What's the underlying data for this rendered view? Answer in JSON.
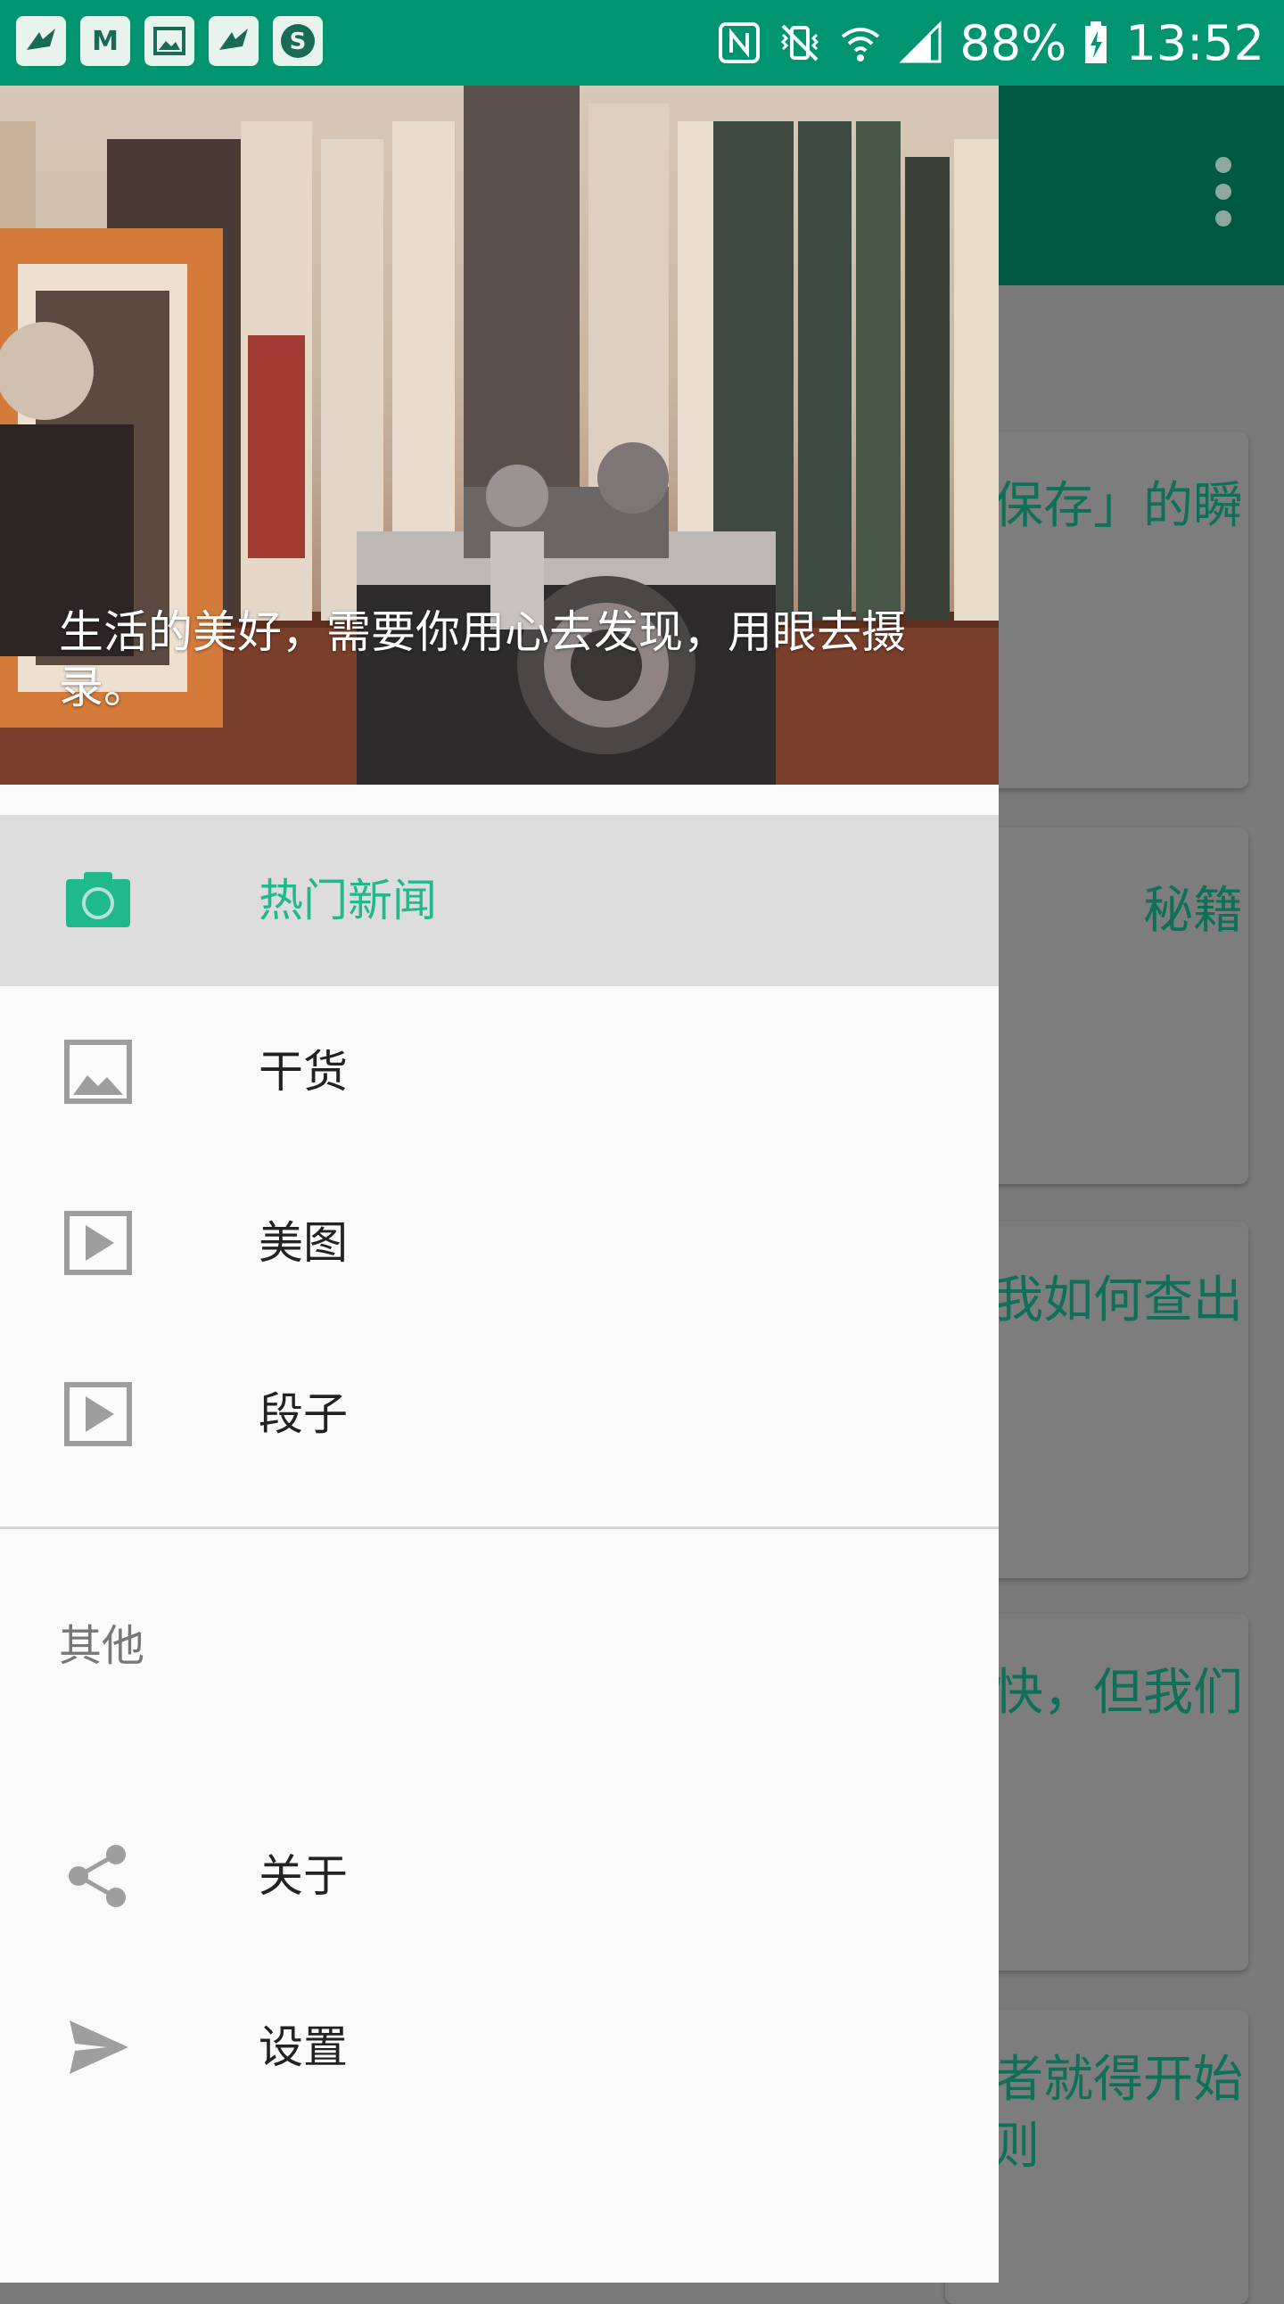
{
  "status_bar": {
    "app_icons": [
      "bird-notification-icon",
      "m-app-icon",
      "image-notification-icon",
      "bird-notification-icon",
      "s-app-icon"
    ],
    "system_icons": [
      "nfc-icon",
      "vibrate-mute-icon",
      "wifi-icon",
      "signal-icon"
    ],
    "battery": "88%",
    "time": "13:52"
  },
  "main_screen": {
    "cards": [
      "保存」的瞬",
      "秘籍",
      "我如何查出",
      "快，但我们",
      "者就得开始"
    ],
    "card_extra_line": "则"
  },
  "drawer": {
    "header_text": "生活的美好，需要你用心去发现，用眼去摄录。",
    "menu_items": [
      {
        "label": "热门新闻",
        "icon": "camera-icon",
        "selected": true
      },
      {
        "label": "干货",
        "icon": "image-icon",
        "selected": false
      },
      {
        "label": "美图",
        "icon": "play-box-icon",
        "selected": false
      },
      {
        "label": "段子",
        "icon": "play-box-icon",
        "selected": false
      }
    ],
    "section_title": "其他",
    "other_items": [
      {
        "label": "关于",
        "icon": "share-icon"
      },
      {
        "label": "设置",
        "icon": "send-icon"
      }
    ]
  },
  "colors": {
    "status_bar": "#009470",
    "accent": "#1fb98c",
    "app_bar_dimmed": "#005a43"
  }
}
